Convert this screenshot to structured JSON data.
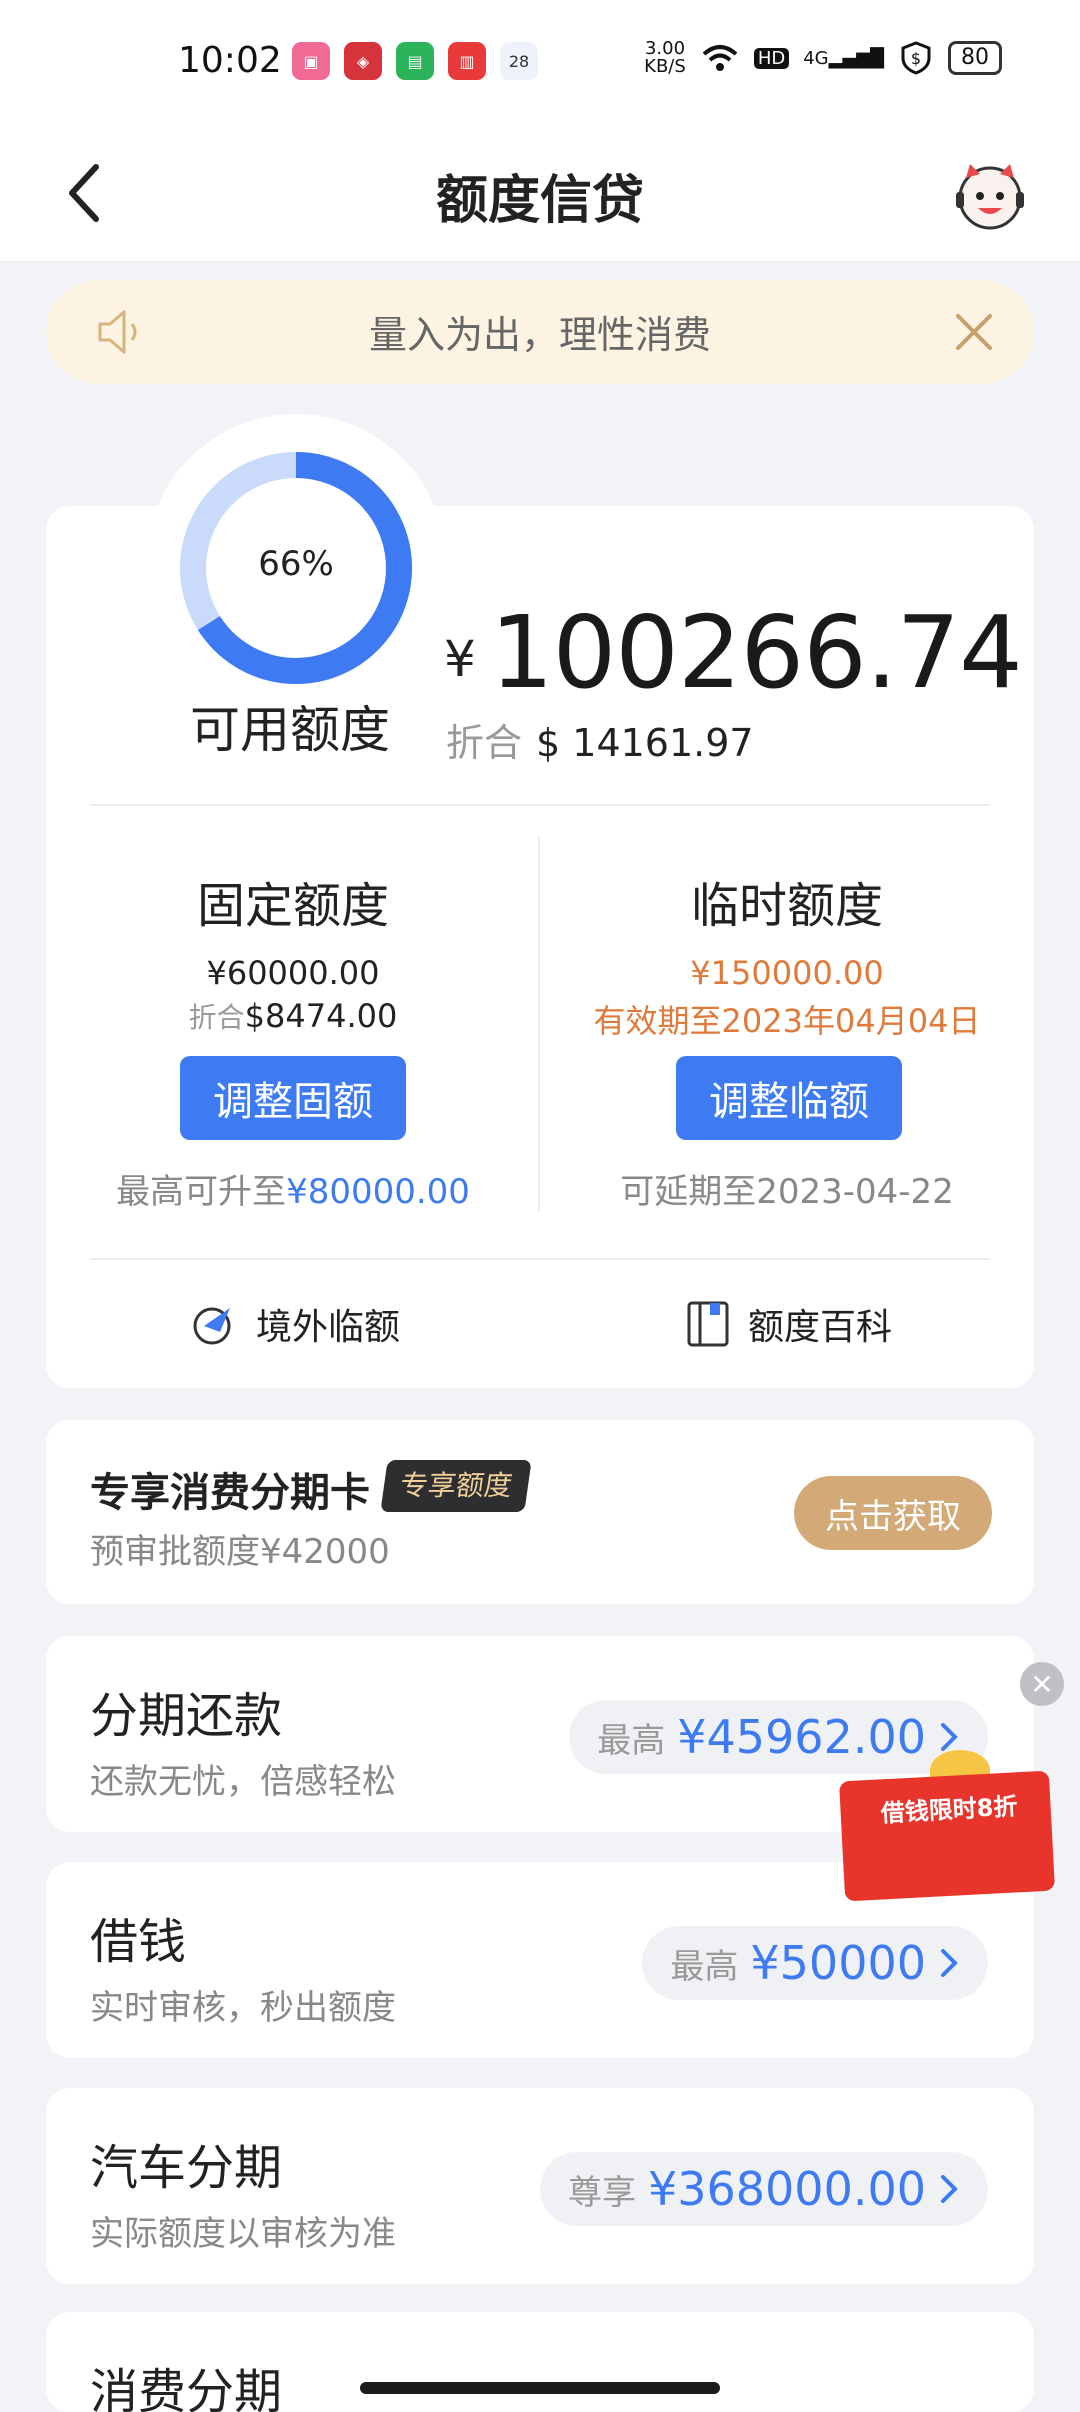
{
  "status_bar": {
    "time": "10:02",
    "net_speed": "3.00\nKB/S",
    "hd": "HD",
    "signal": "4G",
    "battery": "80",
    "calendar_day": "28"
  },
  "header": {
    "title": "额度信贷"
  },
  "notice": {
    "text": "量入为出，理性消费"
  },
  "credit": {
    "percent": "66%",
    "percent_value": 0.66,
    "available_label": "可用额度",
    "currency_symbol": "¥",
    "available_amount": "100266.74",
    "convert_prefix": "折合",
    "convert_amount": "$ 14161.97",
    "fixed": {
      "title": "固定额度",
      "amount": "¥60000.00",
      "convert_prefix": "折合",
      "convert_amount": "$8474.00",
      "button": "调整固额",
      "foot_prefix": "最高可升至",
      "foot_amount": "¥80000.00"
    },
    "temp": {
      "title": "临时额度",
      "amount": "¥150000.00",
      "valid": "有效期至2023年04月04日",
      "button": "调整临额",
      "foot": "可延期至2023-04-22"
    },
    "links": {
      "overseas": "境外临额",
      "wiki": "额度百科"
    }
  },
  "installment_card": {
    "title": "专享消费分期卡",
    "tag": "专享额度",
    "subtitle": "预审批额度¥42000",
    "button": "点击获取"
  },
  "rows": [
    {
      "title": "分期还款",
      "subtitle": "还款无忧，倍感轻松",
      "prefix": "最高",
      "amount": "¥45962.00"
    },
    {
      "title": "借钱",
      "subtitle": "实时审核，秒出额度",
      "prefix": "最高",
      "amount": "¥50000"
    },
    {
      "title": "汽车分期",
      "subtitle": "实际额度以审核为准",
      "prefix": "尊享",
      "amount": "¥368000.00"
    },
    {
      "title": "消费分期"
    }
  ],
  "promo": {
    "text": "借钱限时8折"
  },
  "colors": {
    "accent_blue": "#3e7bf2",
    "ring_light": "#c9dafb",
    "orange": "#e07a3a",
    "gold": "#d3a977"
  }
}
